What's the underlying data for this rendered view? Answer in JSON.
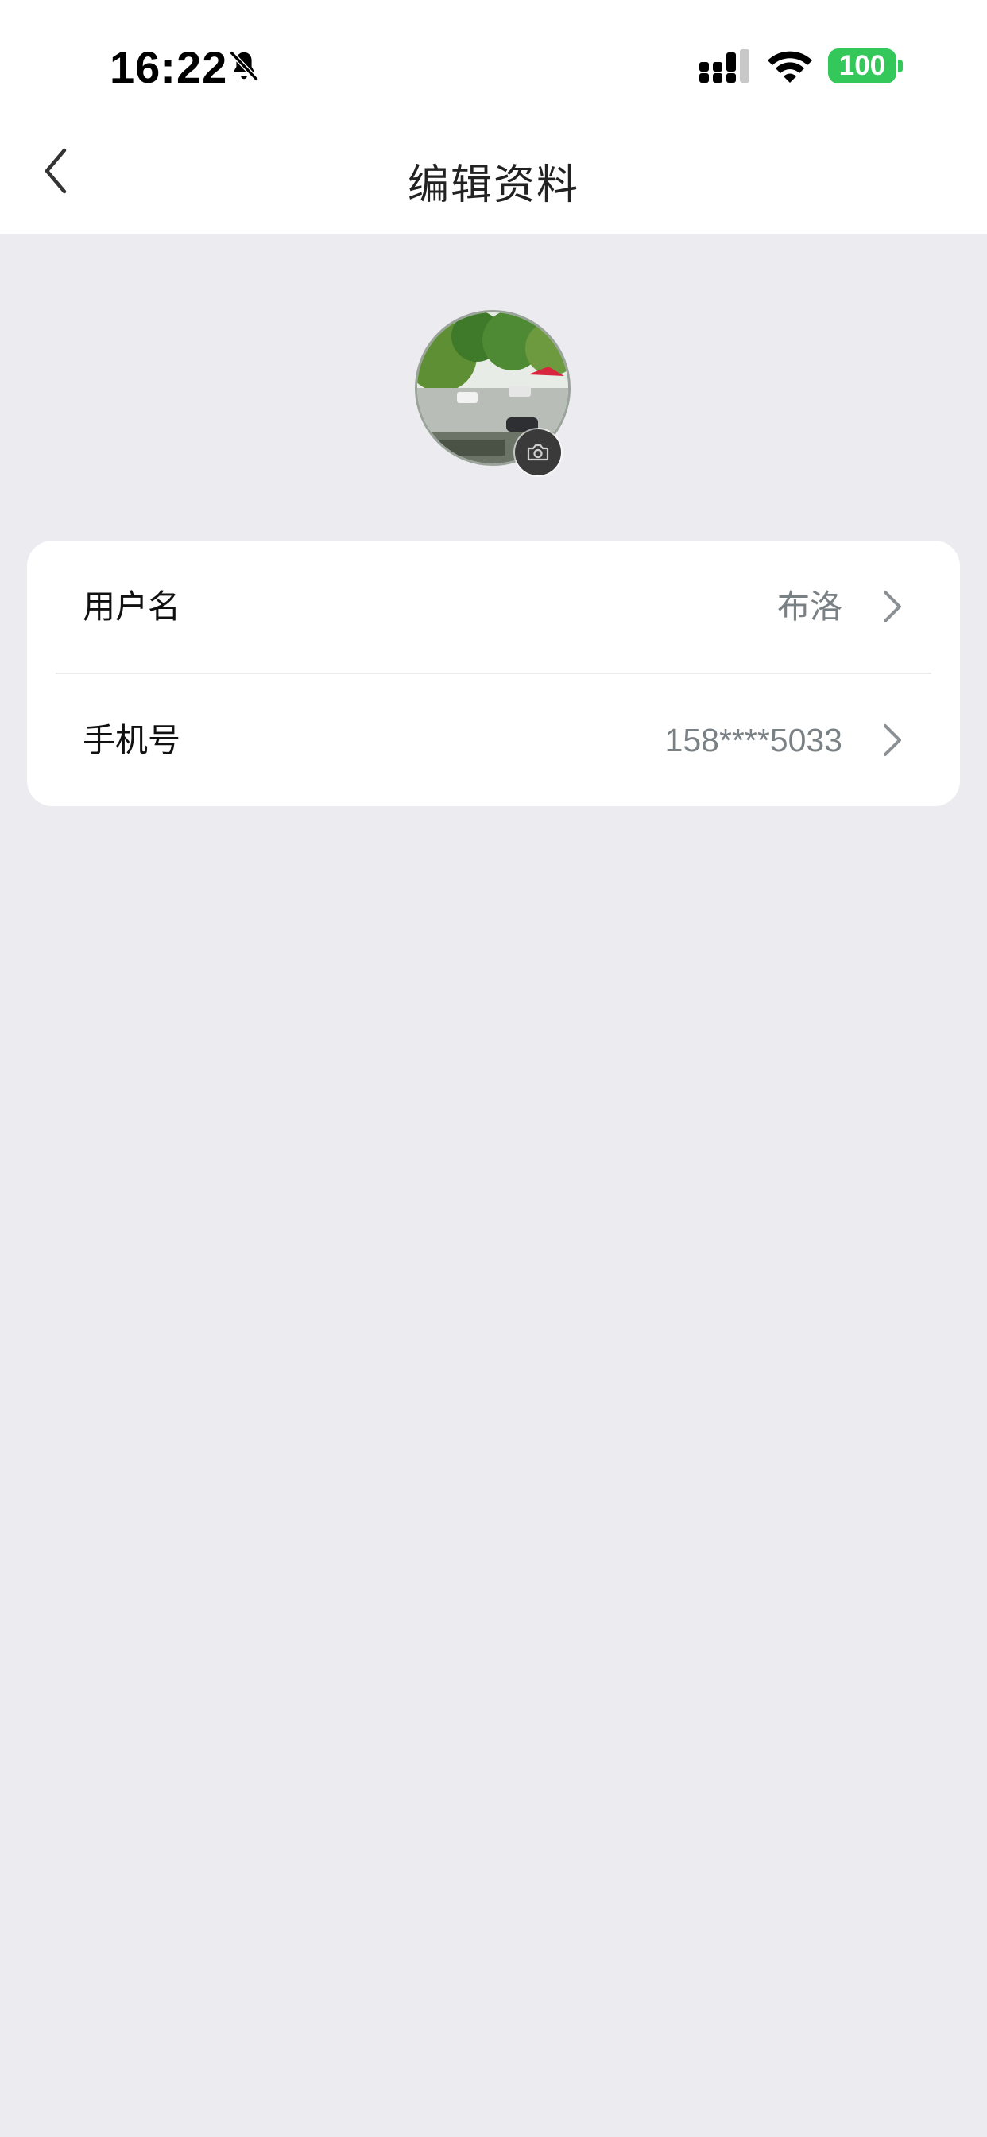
{
  "status_bar": {
    "time": "16:22",
    "battery": "100",
    "battery_color": "#34c759",
    "icons": [
      "bell-slash-icon",
      "cellular-signal-icon",
      "wifi-icon",
      "battery-icon"
    ]
  },
  "header": {
    "title": "编辑资料",
    "back_icon": "chevron-left-icon"
  },
  "avatar": {
    "badge_icon": "camera-icon"
  },
  "profile_fields": [
    {
      "label": "用户名",
      "value": "布洛"
    },
    {
      "label": "手机号",
      "value": "158****5033"
    }
  ],
  "colors": {
    "background": "#ececf0",
    "card": "#ffffff",
    "value_text": "#7a8185"
  }
}
